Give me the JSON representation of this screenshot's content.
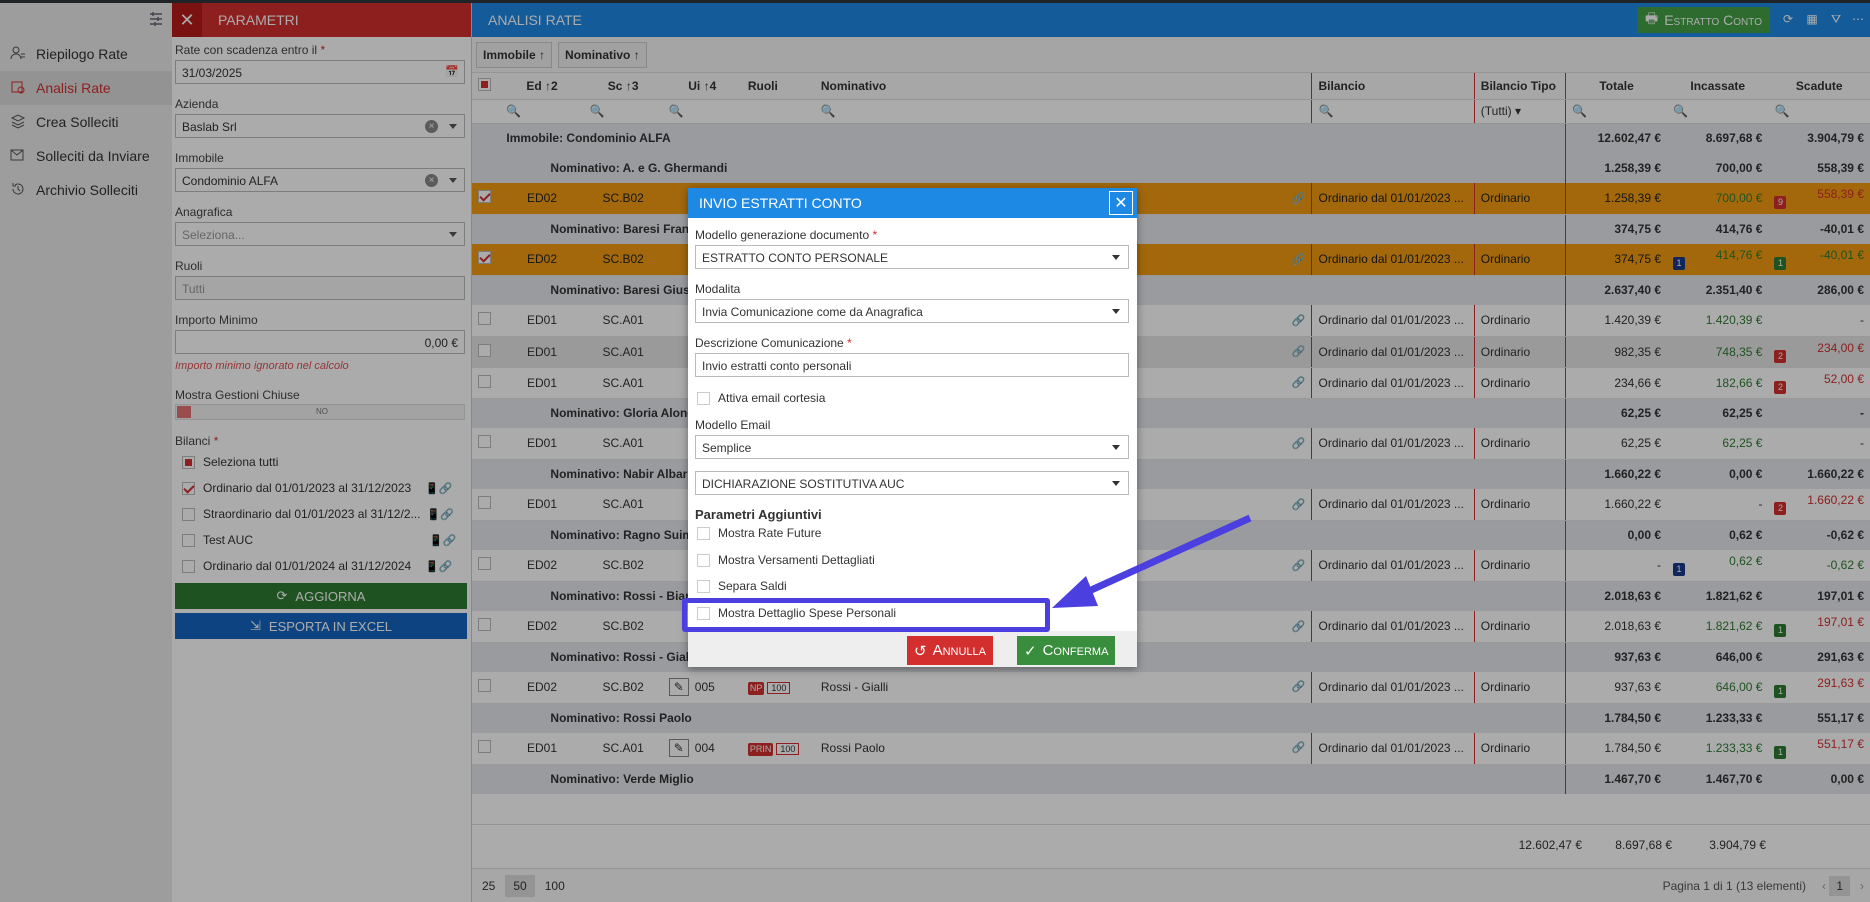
{
  "nav": {
    "items": [
      {
        "label": "Riepilogo Rate",
        "icon": "user-list-icon"
      },
      {
        "label": "Analisi Rate",
        "icon": "report-icon"
      },
      {
        "label": "Crea Solleciti",
        "icon": "stack-icon"
      },
      {
        "label": "Solleciti da Inviare",
        "icon": "send-icon"
      },
      {
        "label": "Archivio Solleciti",
        "icon": "history-icon"
      }
    ]
  },
  "params": {
    "title": "PARAMETRI",
    "scadenza_label": "Rate con scadenza entro il",
    "scadenza_value": "31/03/2025",
    "azienda_label": "Azienda",
    "azienda_value": "Baslab Srl",
    "immobile_label": "Immobile",
    "immobile_value": "Condominio ALFA",
    "anagrafica_label": "Anagrafica",
    "anagrafica_placeholder": "Seleziona...",
    "ruoli_label": "Ruoli",
    "ruoli_placeholder": "Tutti",
    "importo_label": "Importo Minimo",
    "importo_value": "0,00 €",
    "importo_note": "Importo minimo ignorato nel calcolo",
    "gestioni_label": "Mostra Gestioni Chiuse",
    "gestioni_toggle": "NO",
    "bilanci_label": "Bilanci",
    "seleziona_tutti": "Seleziona tutti",
    "bilanci": [
      {
        "label": "Ordinario dal 01/01/2023 al 31/12/2023",
        "checked": true
      },
      {
        "label": "Straordinario dal 01/01/2023 al 31/12/2...",
        "checked": false
      },
      {
        "label": "Test AUC",
        "checked": false
      },
      {
        "label": "Ordinario dal 01/01/2024 al 31/12/2024",
        "checked": false
      }
    ],
    "aggiorna": "AGGIORNA",
    "esporta": "ESPORTA IN EXCEL"
  },
  "main": {
    "title": "ANALISI RATE",
    "estratto_btn": "Estratto Conto",
    "group_chips": [
      "Immobile",
      "Nominativo"
    ],
    "columns": {
      "ed": "Ed",
      "ed_sort": "2",
      "sc": "Sc",
      "sc_sort": "3",
      "ui": "Ui",
      "ui_sort": "4",
      "ruoli": "Ruoli",
      "nominativo": "Nominativo",
      "bilancio": "Bilancio",
      "bilancio_tipo": "Bilancio Tipo",
      "totale": "Totale",
      "incassate": "Incassate",
      "scadute": "Scadute"
    },
    "filter_tipo": "(Tutti)",
    "immobile_group": {
      "label": "Immobile: Condominio ALFA",
      "totale": "12.602,47 €",
      "incassate": "8.697,68 €",
      "scadute": "3.904,79 €"
    },
    "rows": [
      {
        "kind": "grp",
        "label": "Nominativo: A. e G. Ghermandi",
        "totale": "1.258,39 €",
        "incassate": "700,00 €",
        "scadute": "558,39 €"
      },
      {
        "kind": "row",
        "sel": true,
        "ed": "ED02",
        "sc": "SC.B02",
        "bilancio": "Ordinario dal 01/01/2023 ...",
        "tipo": "Ordinario",
        "totale": "1.258,39 €",
        "inc": "700,00 €",
        "inc_badge": "",
        "scad": "558,39 €",
        "scad_badge": "9",
        "scad_badge_color": "red"
      },
      {
        "kind": "grp",
        "label": "Nominativo: Baresi Franco",
        "totale": "374,75 €",
        "incassate": "414,76 €",
        "scadute": "-40,01 €"
      },
      {
        "kind": "row",
        "sel": true,
        "ed": "ED02",
        "sc": "SC.B02",
        "bilancio": "Ordinario dal 01/01/2023 ...",
        "tipo": "Ordinario",
        "totale": "374,75 €",
        "inc": "414,76 €",
        "inc_badge": "1",
        "scad": "-40,01 €",
        "scad_badge": "1",
        "scad_badge_color": "green"
      },
      {
        "kind": "grp",
        "label": "Nominativo: Baresi Giuseppe",
        "totale": "2.637,40 €",
        "incassate": "2.351,40 €",
        "scadute": "286,00 €"
      },
      {
        "kind": "row",
        "ed": "ED01",
        "sc": "SC.A01",
        "bilancio": "Ordinario dal 01/01/2023 ...",
        "tipo": "Ordinario",
        "totale": "1.420,39 €",
        "inc": "1.420,39 €",
        "inc_badge": "",
        "scad": "-",
        "scad_badge": ""
      },
      {
        "kind": "row",
        "hover": true,
        "ed": "ED01",
        "sc": "SC.A01",
        "bilancio": "Ordinario dal 01/01/2023 ...",
        "tipo": "Ordinario",
        "totale": "982,35 €",
        "inc": "748,35 €",
        "inc_badge": "",
        "scad": "234,00 €",
        "scad_badge": "2",
        "scad_badge_color": "red"
      },
      {
        "kind": "row",
        "ed": "ED01",
        "sc": "SC.A01",
        "bilancio": "Ordinario dal 01/01/2023 ...",
        "tipo": "Ordinario",
        "totale": "234,66 €",
        "inc": "182,66 €",
        "inc_badge": "",
        "scad": "52,00 €",
        "scad_badge": "2",
        "scad_badge_color": "red"
      },
      {
        "kind": "grp",
        "label": "Nominativo: Gloria Alongi",
        "totale": "62,25 €",
        "incassate": "62,25 €",
        "scadute": "-"
      },
      {
        "kind": "row",
        "ed": "ED01",
        "sc": "SC.A01",
        "bilancio": "Ordinario dal 01/01/2023 ...",
        "tipo": "Ordinario",
        "totale": "62,25 €",
        "inc": "62,25 €",
        "inc_badge": "",
        "scad": "-",
        "scad_badge": ""
      },
      {
        "kind": "grp",
        "label": "Nominativo: Nabir Albar",
        "totale": "1.660,22 €",
        "incassate": "0,00 €",
        "scadute": "1.660,22 €"
      },
      {
        "kind": "row",
        "ed": "ED01",
        "sc": "SC.A01",
        "bilancio": "Ordinario dal 01/01/2023 ...",
        "tipo": "Ordinario",
        "totale": "1.660,22 €",
        "inc": "-",
        "inc_badge": "",
        "scad": "1.660,22 €",
        "scad_badge": "2",
        "scad_badge_color": "red"
      },
      {
        "kind": "grp",
        "label": "Nominativo: Ragno Suimuri",
        "totale": "0,00 €",
        "incassate": "0,62 €",
        "scadute": "-0,62 €"
      },
      {
        "kind": "row",
        "ed": "ED02",
        "sc": "SC.B02",
        "bilancio": "Ordinario dal 01/01/2023 ...",
        "tipo": "Ordinario",
        "totale": "-",
        "inc": "0,62 €",
        "inc_badge": "1",
        "scad": "-0,62 €",
        "scad_badge": ""
      },
      {
        "kind": "grp",
        "label": "Nominativo: Rossi - Bianchi",
        "totale": "2.018,63 €",
        "incassate": "1.821,62 €",
        "scadute": "197,01 €"
      },
      {
        "kind": "row",
        "ed": "ED02",
        "sc": "SC.B02",
        "bilancio": "Ordinario dal 01/01/2023 ...",
        "tipo": "Ordinario",
        "totale": "2.018,63 €",
        "inc": "1.821,62 €",
        "inc_badge": "",
        "scad": "197,01 €",
        "scad_badge": "1",
        "scad_badge_color": "green"
      },
      {
        "kind": "grp",
        "label": "Nominativo: Rossi - Gialli",
        "totale": "937,63 €",
        "incassate": "646,00 €",
        "scadute": "291,63 €"
      },
      {
        "kind": "row",
        "ed": "ED02",
        "sc": "SC.B02",
        "ui": "005",
        "ruolo": "NP",
        "ruolo_pct": "100",
        "nominativo": "Rossi - Gialli",
        "bilancio": "Ordinario dal 01/01/2023 ...",
        "tipo": "Ordinario",
        "totale": "937,63 €",
        "inc": "646,00 €",
        "inc_badge": "",
        "scad": "291,63 €",
        "scad_badge": "1",
        "scad_badge_color": "green"
      },
      {
        "kind": "grp",
        "label": "Nominativo: Rossi Paolo",
        "totale": "1.784,50 €",
        "incassate": "1.233,33 €",
        "scadute": "551,17 €"
      },
      {
        "kind": "row",
        "ed": "ED01",
        "sc": "SC.A01",
        "ui": "004",
        "ruolo": "PRIN",
        "ruolo_pct": "100",
        "nominativo": "Rossi Paolo",
        "bilancio": "Ordinario dal 01/01/2023 ...",
        "tipo": "Ordinario",
        "totale": "1.784,50 €",
        "inc": "1.233,33 €",
        "inc_badge": "",
        "scad": "551,17 €",
        "scad_badge": "1",
        "scad_badge_color": "green"
      },
      {
        "kind": "grp",
        "label": "Nominativo: Verde Miglio",
        "totale": "1.467,70 €",
        "incassate": "1.467,70 €",
        "scadute": "0,00 €"
      }
    ],
    "totals": {
      "totale": "12.602,47 €",
      "incassate": "8.697,68 €",
      "scadute": "3.904,79 €"
    },
    "pager": {
      "sizes": [
        "25",
        "50",
        "100"
      ],
      "info": "Pagina 1 di 1 (13 elementi)",
      "page": "1"
    }
  },
  "modal": {
    "title": "INVIO ESTRATTI CONTO",
    "modello_label": "Modello generazione documento",
    "modello_value": "ESTRATTO CONTO PERSONALE",
    "modalita_label": "Modalita",
    "modalita_value": "Invia Comunicazione come da Anagrafica",
    "descr_label": "Descrizione Comunicazione",
    "descr_value": "Invio estratti conto personali",
    "cortesia_label": "Attiva email cortesia",
    "email_label": "Modello Email",
    "email_value": "Semplice",
    "dichiarazione_value": "DICHIARAZIONE SOSTITUTIVA AUC",
    "param_title": "Parametri Aggiuntivi",
    "opts": [
      "Mostra Rate Future",
      "Mostra Versamenti Dettagliati",
      "Separa Saldi",
      "Mostra Dettaglio Spese Personali"
    ],
    "annulla": "Annulla",
    "conferma": "Conferma"
  },
  "colors": {
    "red": "#d32f2f",
    "blue": "#1e88e5",
    "green": "#43a047",
    "highlight": "#4b3fe0",
    "selected_row": "#f39c12"
  }
}
